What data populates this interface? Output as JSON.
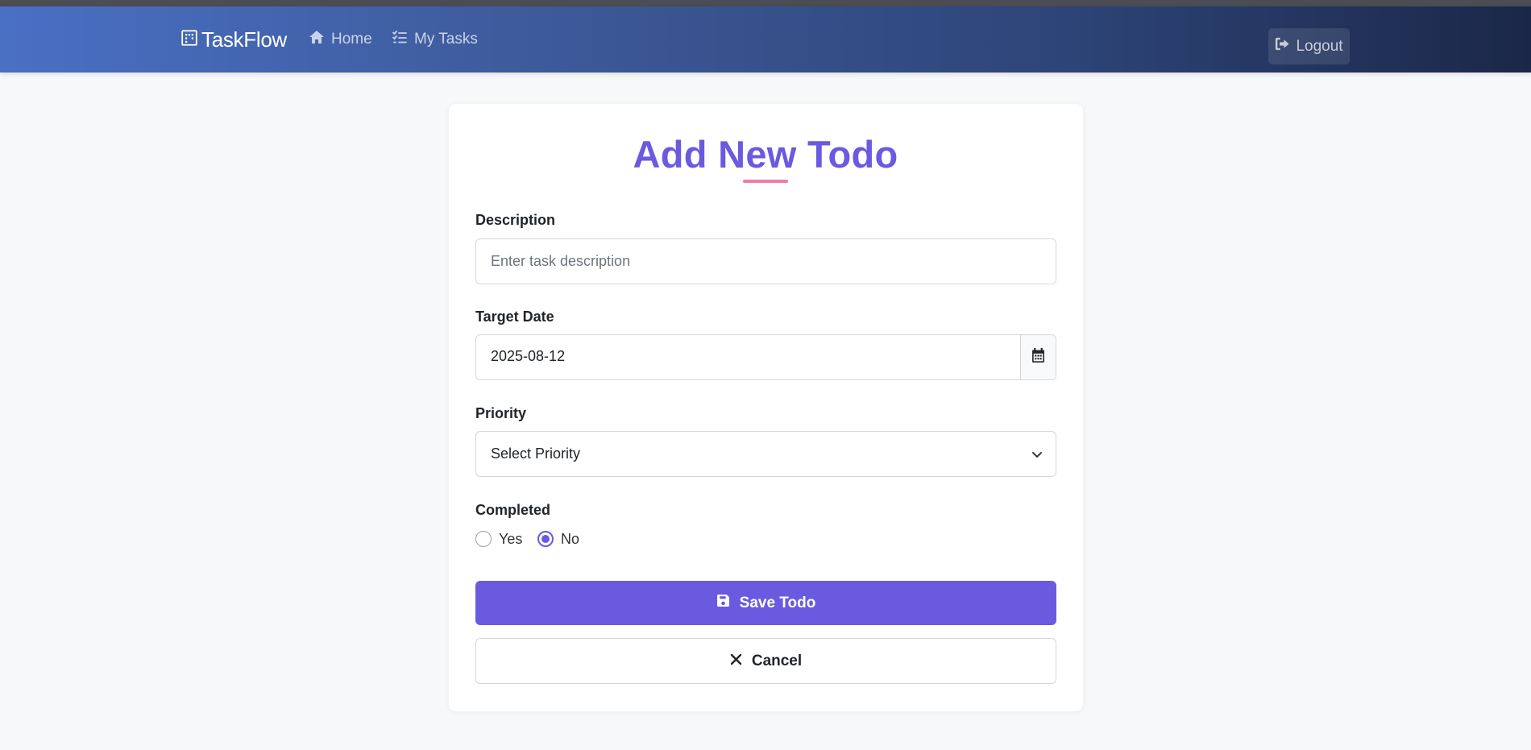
{
  "nav": {
    "brand": "TaskFlow",
    "brand_icon": "building-icon",
    "home_label": "Home",
    "home_icon": "home-icon",
    "tasks_label": "My Tasks",
    "tasks_icon": "list-check-icon",
    "logout_label": "Logout",
    "logout_icon": "sign-out-icon"
  },
  "form": {
    "title": "Add New Todo",
    "description": {
      "label": "Description",
      "placeholder": "Enter task description",
      "value": ""
    },
    "target_date": {
      "label": "Target Date",
      "value": "2025-08-12",
      "icon": "calendar-icon"
    },
    "priority": {
      "label": "Priority",
      "selected": "Select Priority"
    },
    "completed": {
      "label": "Completed",
      "options": [
        "Yes",
        "No"
      ],
      "selected": "No"
    },
    "save_label": "Save Todo",
    "cancel_label": "Cancel"
  },
  "colors": {
    "accent": "#6a5ae0",
    "underline": "#f17aa9",
    "nav_start": "#4a70c4",
    "nav_end": "#1b2748"
  }
}
